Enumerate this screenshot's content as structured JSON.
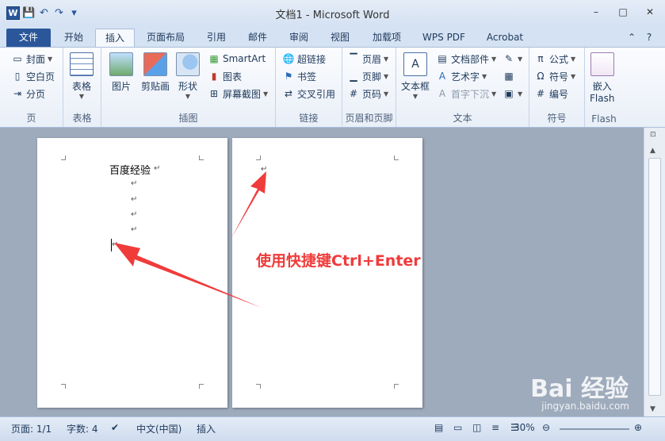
{
  "window": {
    "title": "文档1 - Microsoft Word",
    "min_label": "–",
    "max_label": "□",
    "close_label": "✕"
  },
  "qat": {
    "logo_letter": "W",
    "save": "💾",
    "undo": "↶",
    "redo": "↷",
    "customize": "▾"
  },
  "tabs": [
    "文件",
    "开始",
    "插入",
    "页面布局",
    "引用",
    "邮件",
    "审阅",
    "视图",
    "加载项",
    "WPS PDF",
    "Acrobat"
  ],
  "help": {
    "collapse": "⌃",
    "help": "?"
  },
  "ribbon": {
    "pages": {
      "label": "页",
      "cover": "封面",
      "blank": "空白页",
      "break": "分页"
    },
    "tables": {
      "label": "表格",
      "table": "表格"
    },
    "illustrations": {
      "label": "插图",
      "picture": "图片",
      "clipart": "剪贴画",
      "shapes": "形状",
      "smartart": "SmartArt",
      "chart": "图表",
      "screenshot": "屏幕截图"
    },
    "links": {
      "label": "链接",
      "hyperlink": "超链接",
      "bookmark": "书签",
      "crossref": "交叉引用"
    },
    "header_footer": {
      "label": "页眉和页脚",
      "header": "页眉",
      "footer": "页脚",
      "page_number": "页码"
    },
    "text": {
      "label": "文本",
      "textbox": "文本框",
      "quickparts": "文档部件",
      "wordart": "艺术字",
      "dropcap": "首字下沉"
    },
    "symbols": {
      "label": "符号",
      "equation": "公式",
      "symbol": "符号",
      "number": "编号"
    },
    "flash": {
      "label": "Flash",
      "embed": "嵌入",
      "embed2": "Flash"
    }
  },
  "document": {
    "page1_text": "百度经验",
    "pilcrow": "↵",
    "annotation": "使用快捷键Ctrl+Enter"
  },
  "status": {
    "page": "页面: 1/1",
    "words": "字数: 4",
    "language": "中文(中国)",
    "mode": "插入",
    "zoom": "30%"
  },
  "watermark": {
    "brand": "Bai 经验",
    "url": "jingyan.baidu.com"
  },
  "colors": {
    "accent": "#2b579a",
    "arrow": "#f03b3b"
  }
}
